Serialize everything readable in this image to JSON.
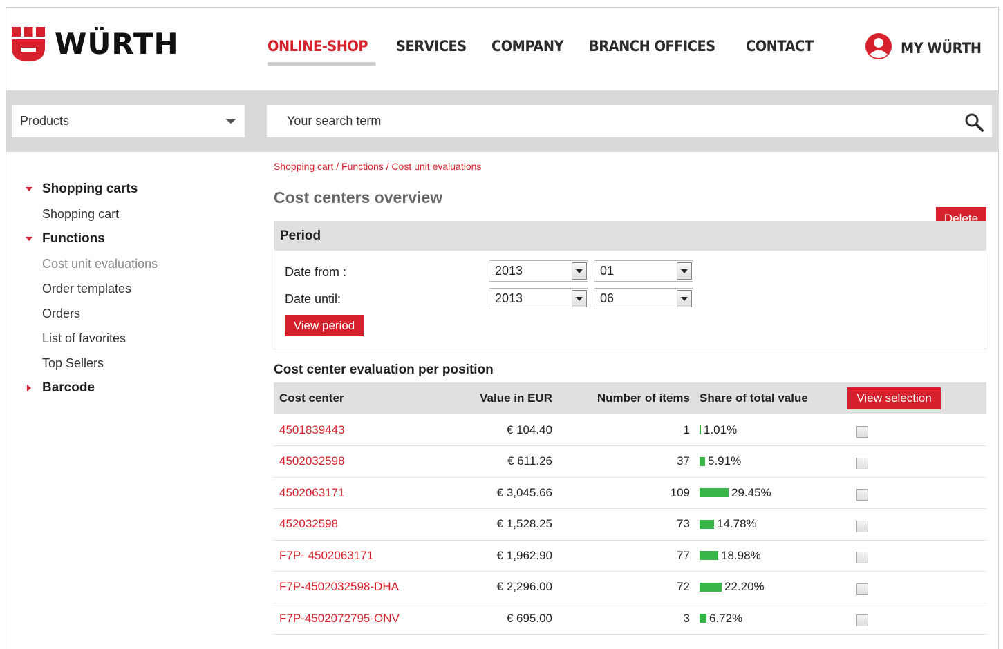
{
  "header": {
    "logo_text": "WÜRTH",
    "nav": [
      {
        "label": "ONLINE-SHOP",
        "active": true
      },
      {
        "label": "SERVICES",
        "active": false
      },
      {
        "label": "COMPANY",
        "active": false
      },
      {
        "label": "BRANCH OFFICES",
        "active": false
      },
      {
        "label": "CONTACT",
        "active": false
      }
    ],
    "account_label": "MY WÜRTH"
  },
  "search": {
    "category": "Products",
    "placeholder": "Your search term"
  },
  "sidebar": {
    "groups": [
      {
        "label": "Shopping carts",
        "expanded": true,
        "items": [
          {
            "label": "Shopping cart",
            "active": false
          }
        ]
      },
      {
        "label": "Functions",
        "expanded": true,
        "items": [
          {
            "label": "Cost unit evaluations",
            "active": true
          },
          {
            "label": "Order templates",
            "active": false
          },
          {
            "label": "Orders",
            "active": false
          },
          {
            "label": "List of favorites",
            "active": false
          },
          {
            "label": "Top Sellers",
            "active": false
          }
        ]
      },
      {
        "label": "Barcode",
        "expanded": false,
        "items": []
      }
    ]
  },
  "main": {
    "breadcrumb": "Shopping cart / Functions / Cost unit evaluations",
    "title": "Cost centers overview",
    "delete_label": "Delete",
    "period": {
      "heading": "Period",
      "date_from_label": "Date from :",
      "date_until_label": "Date until:",
      "from_year": "2013",
      "from_month": "01",
      "until_year": "2013",
      "until_month": "06",
      "view_period_label": "View period"
    },
    "evaluation": {
      "heading": "Cost center evaluation per position",
      "columns": [
        "Cost center",
        "Value in EUR",
        "Number of items",
        "Share of total value"
      ],
      "view_selection_label": "View selection",
      "rows": [
        {
          "cost_center": "4501839443",
          "value": "€ 104.40",
          "items": "1",
          "share": "1.01%",
          "share_pct": 1.01
        },
        {
          "cost_center": "4502032598",
          "value": "€ 611.26",
          "items": "37",
          "share": "5.91%",
          "share_pct": 5.91
        },
        {
          "cost_center": "4502063171",
          "value": "€ 3,045.66",
          "items": "109",
          "share": "29.45%",
          "share_pct": 29.45
        },
        {
          "cost_center": "452032598",
          "value": "€ 1,528.25",
          "items": "73",
          "share": "14.78%",
          "share_pct": 14.78
        },
        {
          "cost_center": "F7P- 4502063171",
          "value": "€ 1,962.90",
          "items": "77",
          "share": "18.98%",
          "share_pct": 18.98
        },
        {
          "cost_center": "F7P-4502032598-DHA",
          "value": "€ 2,296.00",
          "items": "72",
          "share": "22.20%",
          "share_pct": 22.2
        },
        {
          "cost_center": "F7P-4502072795-ONV",
          "value": "€ 695.00",
          "items": "3",
          "share": "6.72%",
          "share_pct": 6.72
        }
      ]
    }
  },
  "colors": {
    "brand_red": "#d6202b",
    "bar_green": "#39b54a"
  }
}
